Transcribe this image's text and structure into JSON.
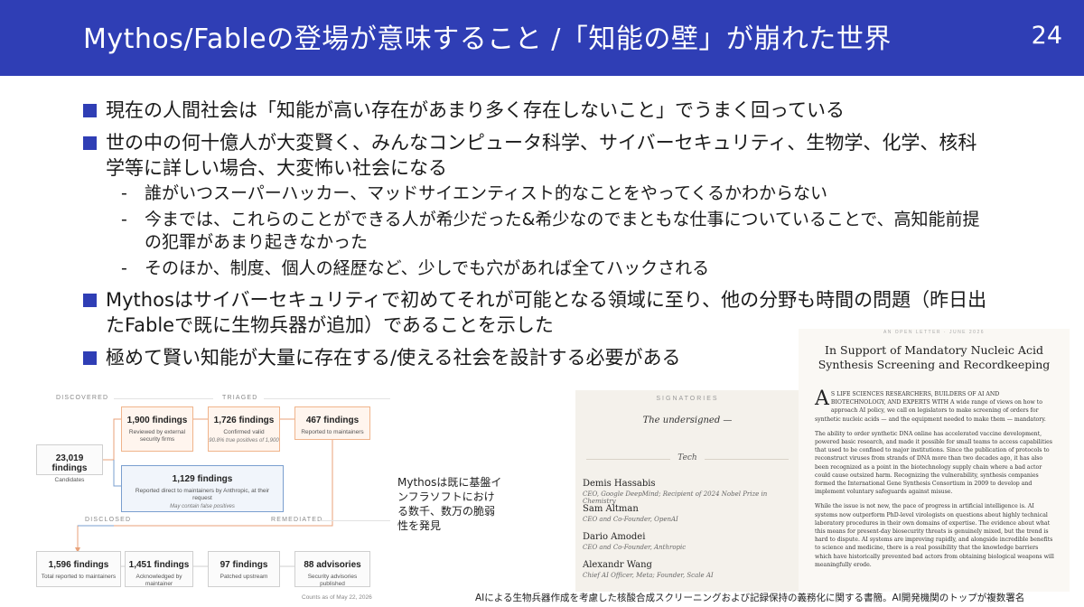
{
  "header": {
    "title": "Mythos/Fableの登場が意味すること /「知能の壁」が崩れた世界",
    "page_number": "24"
  },
  "bullets": [
    {
      "text": "現在の人間社会は「知能が高い存在があまり多く存在しないこと」でうまく回っている"
    },
    {
      "text": "世の中の何十億人が大変賢く、みんなコンピュータ科学、サイバーセキュリティ、生物学、化学、核科学等に詳しい場合、大変怖い社会になる",
      "subs": [
        "誰がいつスーパーハッカー、マッドサイエンティスト的なことをやってくるかわからない",
        "今までは、これらのことができる人が希少だった&希少なのでまともな仕事についていることで、高知能前提の犯罪があまり起きなかった",
        "そのほか、制度、個人の経歴など、少しでも穴があれば全てハックされる"
      ]
    },
    {
      "text": "Mythosはサイバーセキュリティで初めてそれが可能となる領域に至り、他の分野も時間の問題（昨日出たFableで既に生物兵器が追加）であることを示した"
    },
    {
      "text": "極めて賢い知能が大量に存在する/使える社会を設計する必要がある"
    }
  ],
  "flow": {
    "sections": {
      "discovered": "DISCOVERED",
      "triaged": "TRIAGED",
      "disclosed": "DISCLOSED",
      "remediated": "REMEDIATED"
    },
    "candidates": {
      "count": "23,019 findings",
      "desc": "Candidates"
    },
    "external": {
      "count": "1,900 findings",
      "desc": "Reviewed by external security firms"
    },
    "confirmed": {
      "count": "1,726 findings",
      "desc": "Confirmed valid",
      "note": "90.8% true positives of 1,900"
    },
    "reported": {
      "count": "467 findings",
      "desc": "Reported to maintainers"
    },
    "direct": {
      "count": "1,129 findings",
      "desc": "Reported direct to maintainers by Anthropic, at their request",
      "note": "May contain false positives"
    },
    "total_reported": {
      "count": "1,596 findings",
      "desc": "Total reported to maintainers"
    },
    "acknowledged": {
      "count": "1,451 findings",
      "desc": "Acknowledged by maintainer"
    },
    "patched": {
      "count": "97 findings",
      "desc": "Patched upstream"
    },
    "advisories": {
      "count": "88 advisories",
      "desc": "Security advisories published"
    },
    "as_of": "Counts as of May 22, 2026"
  },
  "middle_caption": "Mythosは既に基盤インフラソフトにおける数千、数万の脆弱性を発見",
  "signatories": {
    "heading": "SIGNATORIES",
    "undersigned": "The undersigned —",
    "group": "Tech",
    "people": [
      {
        "name": "Demis Hassabis",
        "role": "CEO, Google DeepMind; Recipient of 2024 Nobel Prize in Chemistry"
      },
      {
        "name": "Sam Altman",
        "role": "CEO and Co-Founder, OpenAI"
      },
      {
        "name": "Dario Amodei",
        "role": "CEO and Co-Founder, Anthropic"
      },
      {
        "name": "Alexandr Wang",
        "role": "Chief AI Officer, Meta; Founder, Scale AI"
      }
    ]
  },
  "letter": {
    "kicker": "AN OPEN LETTER · JUNE 2026",
    "title": "In Support of Mandatory Nucleic Acid Synthesis Screening and Recordkeeping",
    "dropcap": "A",
    "p1": "S LIFE SCIENCES RESEARCHERS, BUILDERS OF AI AND BIOTECHNOLOGY, AND EXPERTS WITH A wide range of views on how to approach AI policy, we call on legislators to make screening of orders for synthetic nucleic acids — and the equipment needed to make them — mandatory.",
    "p2": "The ability to order synthetic DNA online has accelerated vaccine development, powered basic research, and made it possible for small teams to access capabilities that used to be confined to major institutions. Since the publication of protocols to reconstruct viruses from strands of DNA more than two decades ago, it has also been recognized as a point in the biotechnology supply chain where a bad actor could cause outsized harm. Recognizing the vulnerability, synthesis companies formed the International Gene Synthesis Consortium in 2009 to develop and implement voluntary safeguards against misuse.",
    "p3": "While the issue is not new, the pace of progress in artificial intelligence is. AI systems now outperform PhD-level virologists on questions about highly technical laboratory procedures in their own domains of expertise. The evidence about what this means for present-day biosecurity threats is genuinely mixed, but the trend is hard to dispute. AI systems are improving rapidly, and alongside incredible benefits to science and medicine, there is a real possibility that the knowledge barriers which have historically prevented bad actors from obtaining biological weapons will meaningfully erode."
  },
  "bottom_caption": "AIによる生物兵器作成を考慮した核酸合成スクリーニングおよび記録保持の義務化に関する書簡。AI開発機関のトップが複数署名"
}
